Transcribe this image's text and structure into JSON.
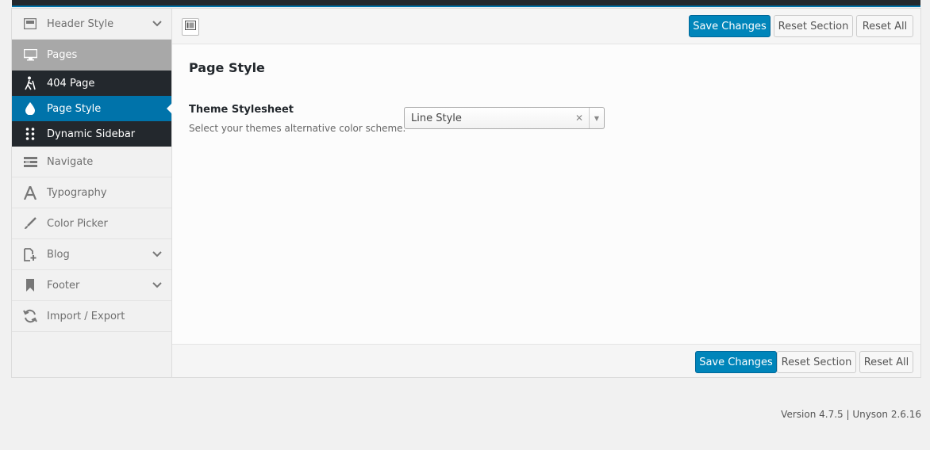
{
  "sidebar": {
    "items_top": [
      {
        "label": "Header Style",
        "icon": "header-layout-icon",
        "has_chevron": true
      }
    ],
    "active_parent": {
      "label": "Pages",
      "icon": "monitor-icon"
    },
    "sub_items": [
      {
        "label": "404 Page",
        "icon": "walking-person-icon",
        "active": false
      },
      {
        "label": "Page Style",
        "icon": "water-drop-icon",
        "active": true
      },
      {
        "label": "Dynamic Sidebar",
        "icon": "dots-grid-icon",
        "active": false
      }
    ],
    "items_bottom": [
      {
        "label": "Navigate",
        "icon": "menu-bars-icon",
        "has_chevron": false
      },
      {
        "label": "Typography",
        "icon": "typography-a-icon",
        "has_chevron": false
      },
      {
        "label": "Color Picker",
        "icon": "brush-icon",
        "has_chevron": false
      },
      {
        "label": "Blog",
        "icon": "add-page-icon",
        "has_chevron": true
      },
      {
        "label": "Footer",
        "icon": "bookmark-icon",
        "has_chevron": true
      },
      {
        "label": "Import / Export",
        "icon": "sync-icon",
        "has_chevron": false
      }
    ]
  },
  "toolbar": {
    "save_label": "Save Changes",
    "reset_section_label": "Reset Section",
    "reset_all_label": "Reset All"
  },
  "content": {
    "section_title": "Page Style",
    "field_label": "Theme Stylesheet",
    "field_description": "Select your themes alternative color scheme.",
    "select_value": "Line Style"
  },
  "footer_bar": {
    "save_label": "Save Changes",
    "reset_section_label": "Reset Section",
    "reset_all_label": "Reset All"
  },
  "version_text": "Version 4.7.5 | Unyson 2.6.16",
  "colors": {
    "primary": "#0085ba",
    "active_sub": "#0073aa",
    "dark_menu": "#23282d",
    "active_parent": "#a8a8a8"
  }
}
